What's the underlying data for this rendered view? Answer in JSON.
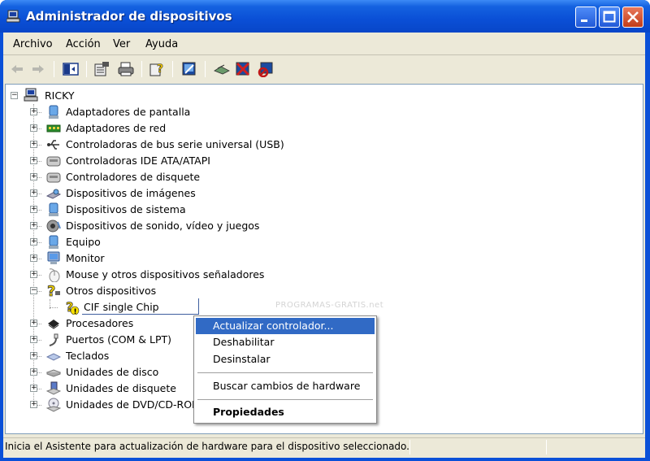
{
  "window": {
    "title": "Administrador de dispositivos",
    "controls": {
      "minimize": "minimize",
      "maximize": "maximize",
      "close": "close"
    }
  },
  "menu": [
    "Archivo",
    "Acción",
    "Ver",
    "Ayuda"
  ],
  "toolbar": {
    "icons": [
      "back-arrow",
      "forward-arrow",
      "show-hide-console-tree",
      "properties",
      "print",
      "help",
      "scan-hardware",
      "update-driver",
      "disable-device",
      "uninstall-device"
    ]
  },
  "tree": {
    "root": "RICKY",
    "items": [
      {
        "label": "Adaptadores de pantalla",
        "icon": "display-adapter",
        "expanded": false
      },
      {
        "label": "Adaptadores de red",
        "icon": "network-adapter",
        "expanded": false
      },
      {
        "label": "Controladoras de bus serie universal (USB)",
        "icon": "usb",
        "expanded": false
      },
      {
        "label": "Controladoras IDE ATA/ATAPI",
        "icon": "ide-controller",
        "expanded": false
      },
      {
        "label": "Controladores de disquete",
        "icon": "floppy-controller",
        "expanded": false
      },
      {
        "label": "Dispositivos de imágenes",
        "icon": "imaging-device",
        "expanded": false
      },
      {
        "label": "Dispositivos de sistema",
        "icon": "system-device",
        "expanded": false
      },
      {
        "label": "Dispositivos de sonido, vídeo y juegos",
        "icon": "sound-device",
        "expanded": false
      },
      {
        "label": "Equipo",
        "icon": "computer",
        "expanded": false
      },
      {
        "label": "Monitor",
        "icon": "monitor",
        "expanded": false
      },
      {
        "label": "Mouse y otros dispositivos señaladores",
        "icon": "mouse",
        "expanded": false
      },
      {
        "label": "Otros dispositivos",
        "icon": "unknown-device",
        "expanded": true
      },
      {
        "label": "Procesadores",
        "icon": "processor",
        "expanded": false
      },
      {
        "label": "Puertos (COM & LPT)",
        "icon": "port",
        "expanded": false
      },
      {
        "label": "Teclados",
        "icon": "keyboard",
        "expanded": false
      },
      {
        "label": "Unidades de disco",
        "icon": "disk-drive",
        "expanded": false
      },
      {
        "label": "Unidades de disquete",
        "icon": "floppy-drive",
        "expanded": false
      },
      {
        "label": "Unidades de DVD/CD-ROM",
        "icon": "cdrom-drive",
        "expanded": false
      }
    ],
    "child": {
      "label": "CIF single Chip",
      "icon": "unknown-device-warning",
      "parent": "Otros dispositivos"
    }
  },
  "context_menu": {
    "items": [
      {
        "label": "Actualizar controlador...",
        "selected": true,
        "bold": false
      },
      {
        "label": "Deshabilitar",
        "selected": false,
        "bold": false
      },
      {
        "label": "Desinstalar",
        "selected": false,
        "bold": false
      },
      {
        "separator": true
      },
      {
        "label": "Buscar cambios de hardware",
        "selected": false,
        "bold": false
      },
      {
        "separator": true
      },
      {
        "label": "Propiedades",
        "selected": false,
        "bold": true
      }
    ]
  },
  "watermark": "PROGRAMAS-GRATIS.net",
  "statusbar": {
    "text": "Inicia el Asistente para actualización de hardware para el dispositivo seleccionado."
  },
  "colors": {
    "titlebar": "#0a4fd6",
    "selection": "#316ac5",
    "client": "#ece9d8",
    "close_button": "#c23c18"
  }
}
